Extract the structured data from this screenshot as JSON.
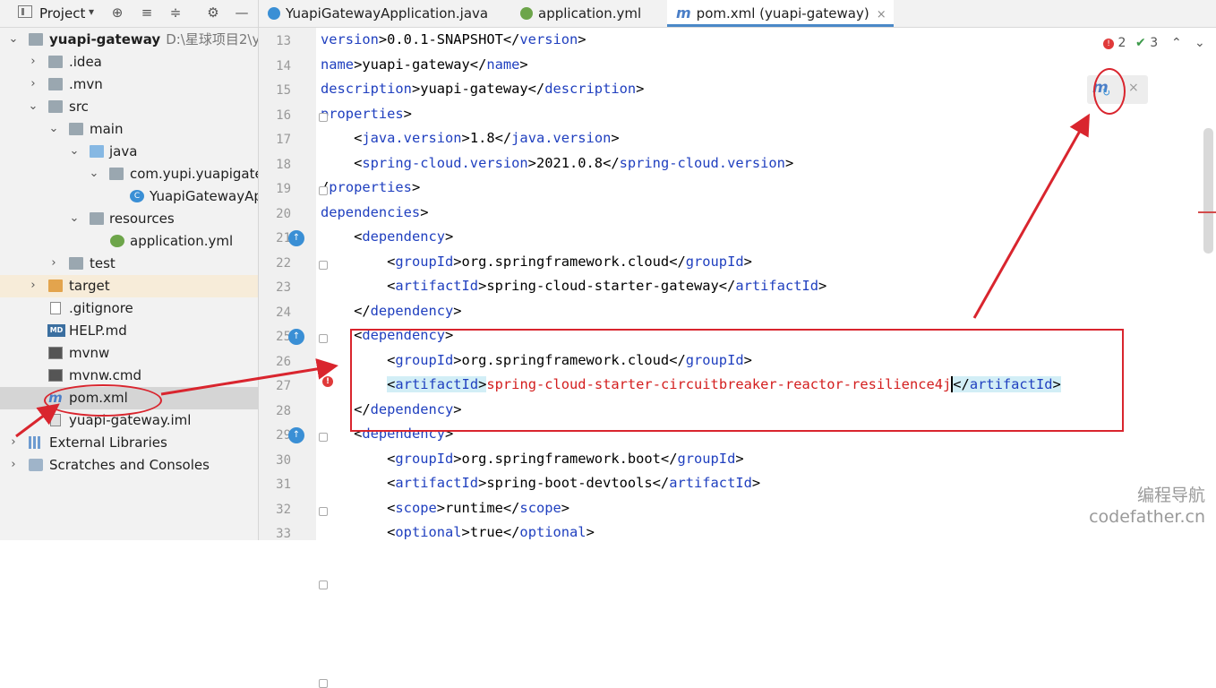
{
  "project_panel": {
    "title": "Project",
    "root": {
      "name": "yuapi-gateway",
      "path": "D:\\星球项目2\\yu"
    },
    "items": [
      {
        "label": ".idea"
      },
      {
        "label": ".mvn"
      },
      {
        "label": "src"
      },
      {
        "label": "main"
      },
      {
        "label": "java"
      },
      {
        "label": "com.yupi.yuapigate"
      },
      {
        "label": "YuapiGatewayAp"
      },
      {
        "label": "resources"
      },
      {
        "label": "application.yml"
      },
      {
        "label": "test"
      },
      {
        "label": "target"
      },
      {
        "label": ".gitignore"
      },
      {
        "label": "HELP.md"
      },
      {
        "label": "mvnw"
      },
      {
        "label": "mvnw.cmd"
      },
      {
        "label": "pom.xml"
      },
      {
        "label": "yuapi-gateway.iml"
      },
      {
        "label": "External Libraries"
      },
      {
        "label": "Scratches and Consoles"
      }
    ]
  },
  "tabs": [
    {
      "label": "YuapiGatewayApplication.java",
      "icon": "spring-class-icon"
    },
    {
      "label": "application.yml",
      "icon": "spring-config-icon"
    },
    {
      "label": "pom.xml (yuapi-gateway)",
      "icon": "maven-icon",
      "close": "×"
    }
  ],
  "inspection": {
    "errors": "2",
    "ok": "3"
  },
  "maven_popup": {
    "close": "×"
  },
  "editor": {
    "lines": [
      {
        "n": "13",
        "text": "version>0.0.1-SNAPSHOT</version>"
      },
      {
        "n": "14",
        "text": "name>yuapi-gateway</name>"
      },
      {
        "n": "15",
        "text": "description>yuapi-gateway</description>"
      },
      {
        "n": "16",
        "text": "properties>"
      },
      {
        "n": "17",
        "text": "    <java.version>1.8</java.version>"
      },
      {
        "n": "18",
        "text": "    <spring-cloud.version>2021.0.8</spring-cloud.version>"
      },
      {
        "n": "19",
        "text": "/properties>"
      },
      {
        "n": "20",
        "text": "dependencies>"
      },
      {
        "n": "21",
        "text": "    <dependency>"
      },
      {
        "n": "22",
        "text": "        <groupId>org.springframework.cloud</groupId>"
      },
      {
        "n": "23",
        "text": "        <artifactId>spring-cloud-starter-gateway</artifactId>"
      },
      {
        "n": "24",
        "text": "    </dependency>"
      },
      {
        "n": "25",
        "text": "    <dependency>"
      },
      {
        "n": "26",
        "text": "        <groupId>org.springframework.cloud</groupId>"
      },
      {
        "n": "27",
        "text": "        <artifactId>spring-cloud-starter-circuitbreaker-reactor-resilience4j</artifactId>"
      },
      {
        "n": "28",
        "text": "    </dependency>"
      },
      {
        "n": "29",
        "text": "    <dependency>"
      },
      {
        "n": "30",
        "text": "        <groupId>org.springframework.boot</groupId>"
      },
      {
        "n": "31",
        "text": "        <artifactId>spring-boot-devtools</artifactId>"
      },
      {
        "n": "32",
        "text": "        <scope>runtime</scope>"
      },
      {
        "n": "33",
        "text": "        <optional>true</optional>"
      }
    ]
  },
  "watermark": {
    "line1": "编程导航",
    "line2": "codefather.cn"
  },
  "colors": {
    "tag": "#1f3fbf",
    "error_text": "#d31d1d",
    "annotation_red": "#d9252e",
    "accent": "#4a88c7"
  }
}
